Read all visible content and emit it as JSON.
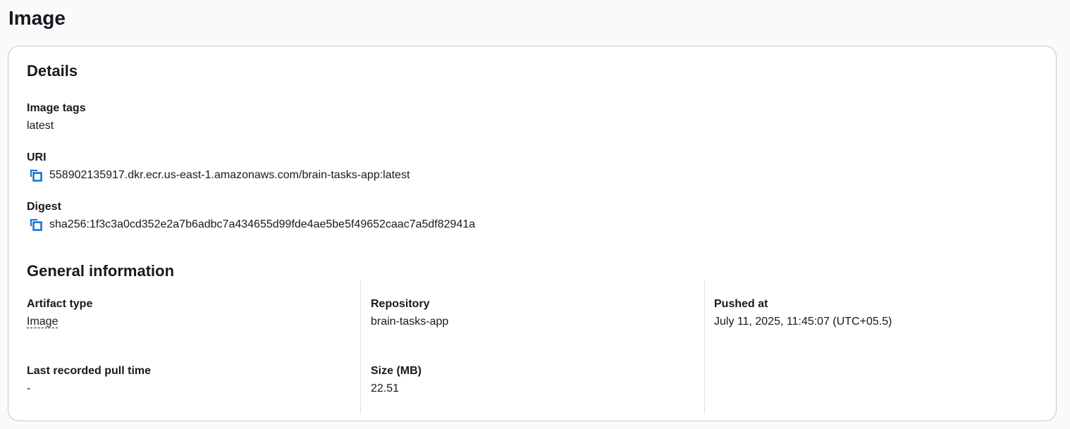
{
  "page": {
    "title": "Image"
  },
  "details": {
    "title": "Details",
    "image_tags": {
      "label": "Image tags",
      "value": "latest"
    },
    "uri": {
      "label": "URI",
      "value": "558902135917.dkr.ecr.us-east-1.amazonaws.com/brain-tasks-app:latest"
    },
    "digest": {
      "label": "Digest",
      "value": "sha256:1f3c3a0cd352e2a7b6adbc7a434655d99fde4ae5be5f49652caac7a5df82941a"
    }
  },
  "general": {
    "title": "General information",
    "artifact_type": {
      "label": "Artifact type",
      "value": "Image"
    },
    "repository": {
      "label": "Repository",
      "value": "brain-tasks-app"
    },
    "pushed_at": {
      "label": "Pushed at",
      "value": "July 11, 2025, 11:45:07 (UTC+05.5)"
    },
    "last_pull": {
      "label": "Last recorded pull time",
      "value": "-"
    },
    "size": {
      "label": "Size (MB)",
      "value": "22.51"
    }
  },
  "colors": {
    "copy_icon": "#0972d3",
    "border": "#c6c6cd",
    "divider": "#e0e0e5",
    "text": "#16191f"
  },
  "icons": {
    "copy": "copy-icon"
  }
}
